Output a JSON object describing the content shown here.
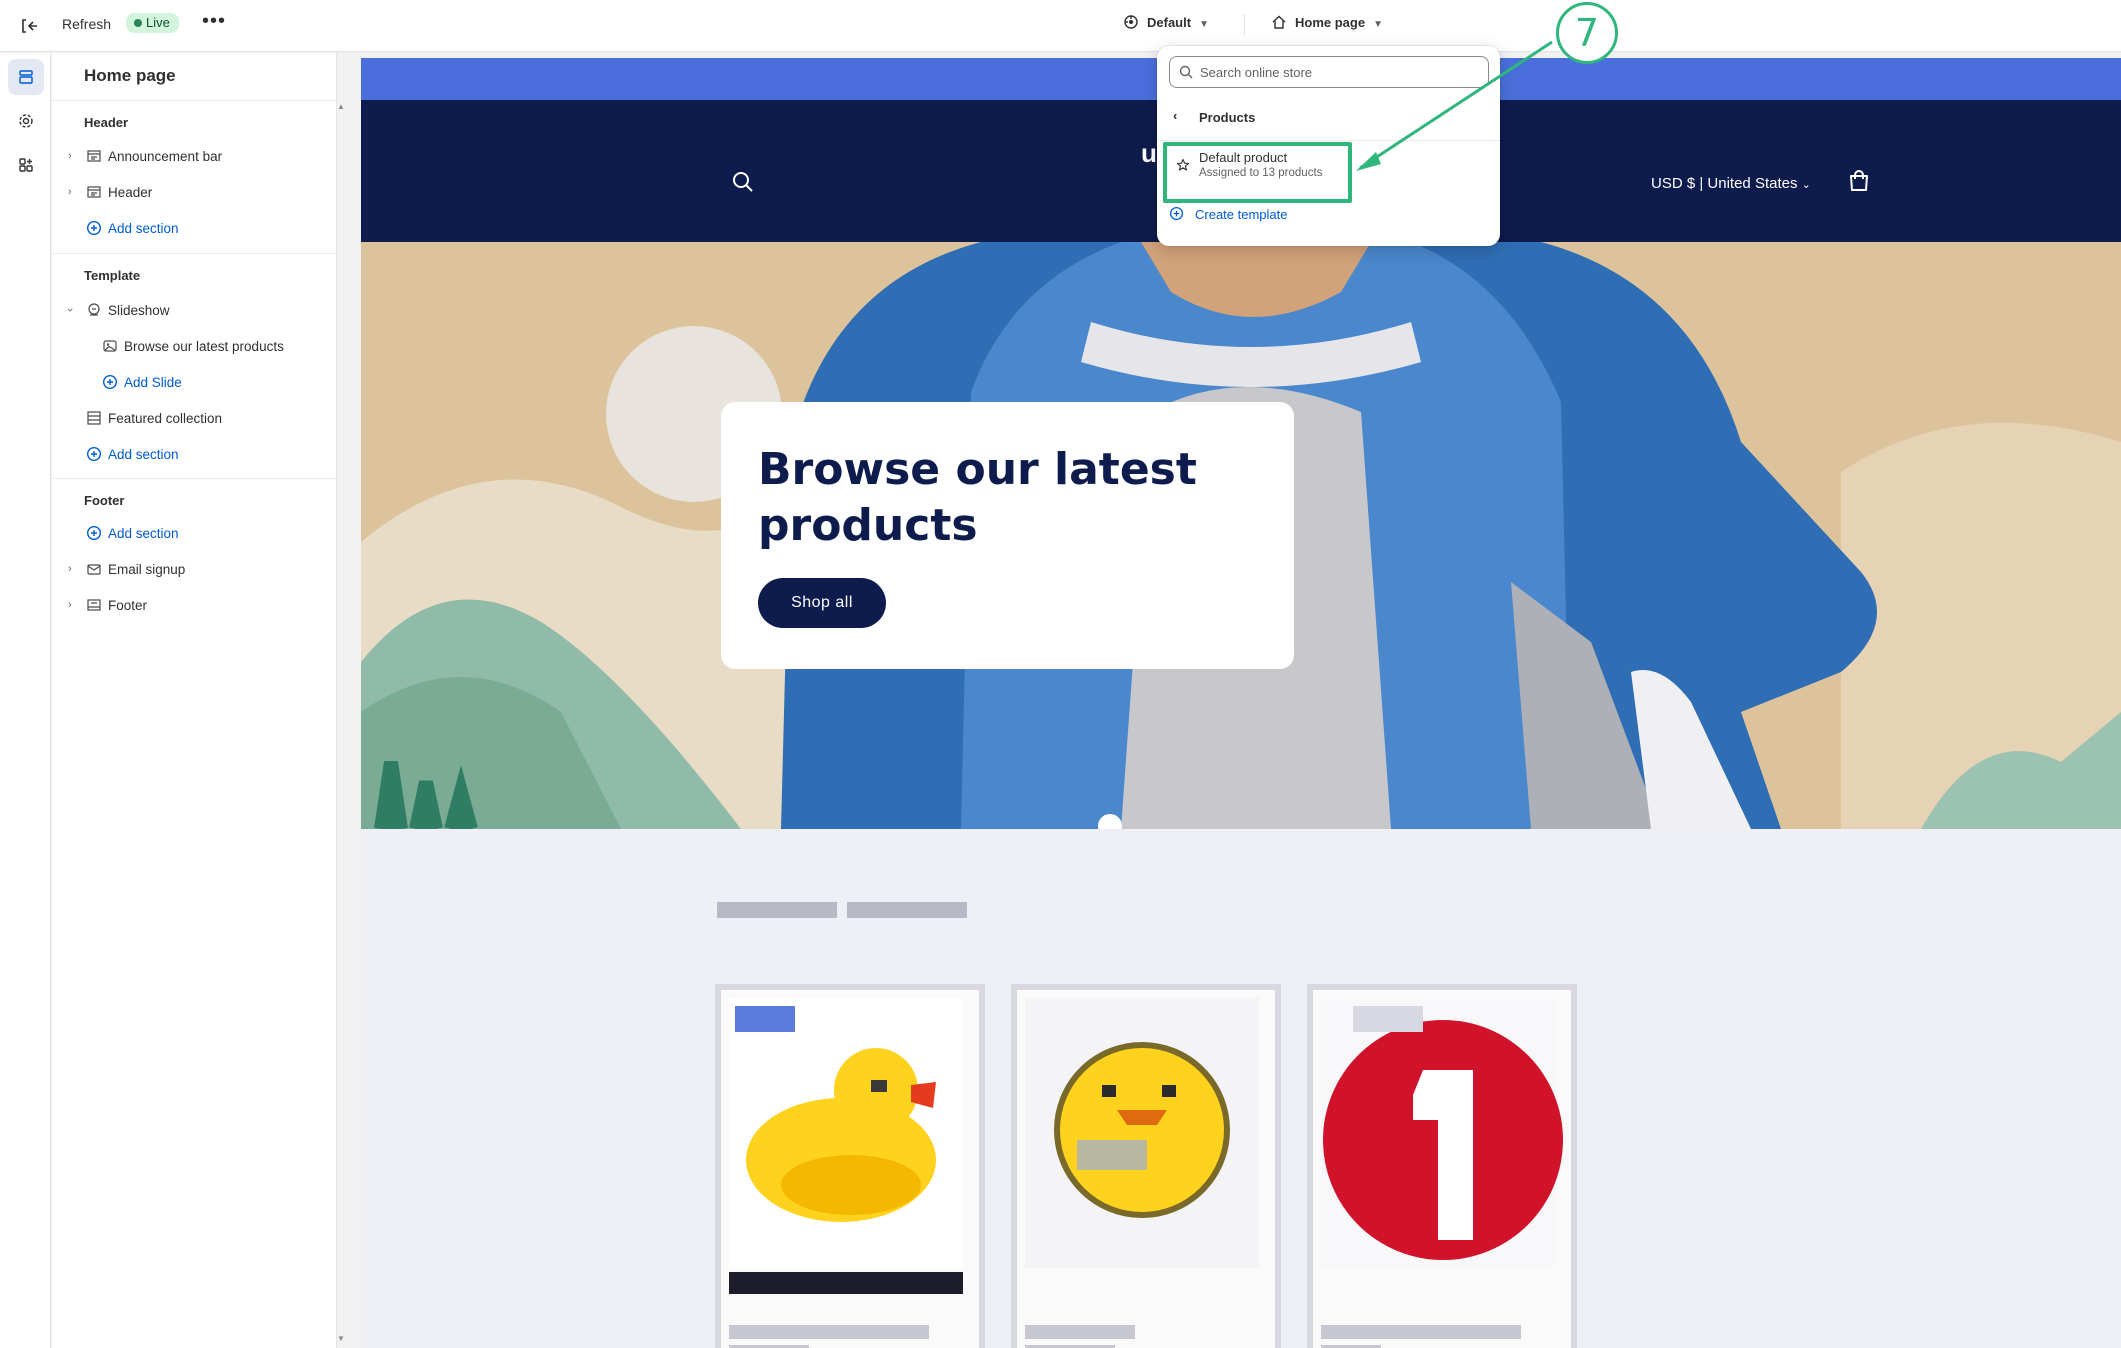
{
  "topbar": {
    "refresh_label": "Refresh",
    "live_badge": "Live",
    "more_label": "•••",
    "theme_selector": "Default",
    "page_selector": "Home page"
  },
  "sidebar": {
    "title": "Home page",
    "groups": {
      "header": {
        "title": "Header",
        "items": [
          "Announcement bar",
          "Header"
        ],
        "add_label": "Add section"
      },
      "template": {
        "title": "Template",
        "slideshow": "Slideshow",
        "slide": "Browse our latest products",
        "add_slide": "Add Slide",
        "featured": "Featured collection",
        "add_label": "Add section"
      },
      "footer": {
        "title": "Footer",
        "add_label": "Add section",
        "items": [
          "Email signup",
          "Footer"
        ]
      }
    }
  },
  "preview": {
    "logo_fragment": "u",
    "currency": "USD $ | United States",
    "hero_heading": "Browse our latest products",
    "hero_button": "Shop all"
  },
  "dropdown": {
    "search_placeholder": "Search online store",
    "back_label": "Products",
    "option_title": "Default product",
    "option_subtitle": "Assigned to 13 products",
    "create_label": "Create template"
  },
  "annotation": {
    "step_number": "7",
    "color": "#2fb67c"
  },
  "colors": {
    "accent": "#005bd3",
    "store_navy": "#0e1b4d",
    "announcement": "#4a6fdc",
    "live_bg": "#d3f5de"
  }
}
